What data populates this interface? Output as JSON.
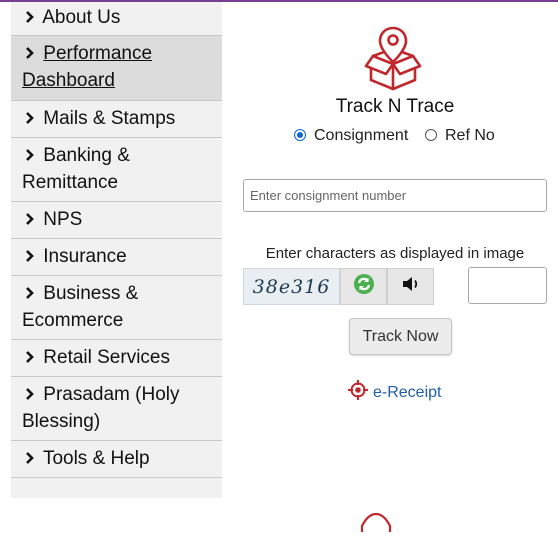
{
  "colors": {
    "accent_purple": "#7a3e8f",
    "brand_red": "#c0282d",
    "link_blue": "#1f5fa3",
    "radio_blue": "#0a66d6"
  },
  "sidebar": {
    "items": [
      {
        "label": "About Us",
        "icon": "chevron-right-icon"
      },
      {
        "label": "Performance Dashboard",
        "icon": "chevron-right-icon",
        "active": true
      },
      {
        "label": "Mails & Stamps",
        "icon": "chevron-right-icon"
      },
      {
        "label": "Banking & Remittance",
        "icon": "chevron-right-icon"
      },
      {
        "label": "NPS",
        "icon": "chevron-right-icon"
      },
      {
        "label": "Insurance",
        "icon": "chevron-right-icon"
      },
      {
        "label": "Business & Ecommerce",
        "icon": "chevron-right-icon"
      },
      {
        "label": "Retail Services",
        "icon": "chevron-right-icon"
      },
      {
        "label": "Prasadam (Holy Blessing)",
        "icon": "chevron-right-icon"
      },
      {
        "label": "Tools & Help",
        "icon": "chevron-right-icon"
      }
    ]
  },
  "track": {
    "icon": "location-box-icon",
    "title": "Track N Trace",
    "options": [
      {
        "label": "Consignment",
        "selected": true
      },
      {
        "label": "Ref No",
        "selected": false
      }
    ],
    "consignment_placeholder": "Enter consignment number",
    "consignment_value": "",
    "captcha_label": "Enter characters as displayed in image",
    "captcha_text": "38e316",
    "refresh_icon": "refresh-icon",
    "audio_icon": "speaker-icon",
    "captcha_value": "",
    "submit_label": "Track Now",
    "ereceipt_label": "e-Receipt",
    "ereceipt_icon": "crosshair-icon"
  }
}
